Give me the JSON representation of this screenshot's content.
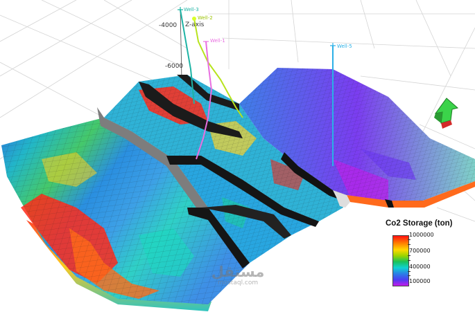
{
  "axis": {
    "z_label": "Z-axis",
    "ticks": [
      "-4000",
      "-6000"
    ]
  },
  "wells": [
    {
      "label": "Well-3",
      "color": "#1db3a4"
    },
    {
      "label": "Well-2",
      "color": "#b7e31c"
    },
    {
      "label": "Well-1",
      "color": "#e86fe0"
    },
    {
      "label": "Well-5",
      "color": "#2bb0e6"
    }
  ],
  "legend": {
    "title": "Co2 Storage (ton)",
    "ticks": [
      "1000000",
      "700000",
      "400000",
      "100000"
    ],
    "colors": [
      "#ff1010",
      "#ff7a00",
      "#ffd800",
      "#9ad400",
      "#19c15b",
      "#10d2d2",
      "#2a7fe6",
      "#4c3df2",
      "#c41bea"
    ]
  },
  "nav_icon": "orientation-arrow-icon",
  "watermark": {
    "text_arabic": "مستقل",
    "text_url": "mostaql.com"
  }
}
